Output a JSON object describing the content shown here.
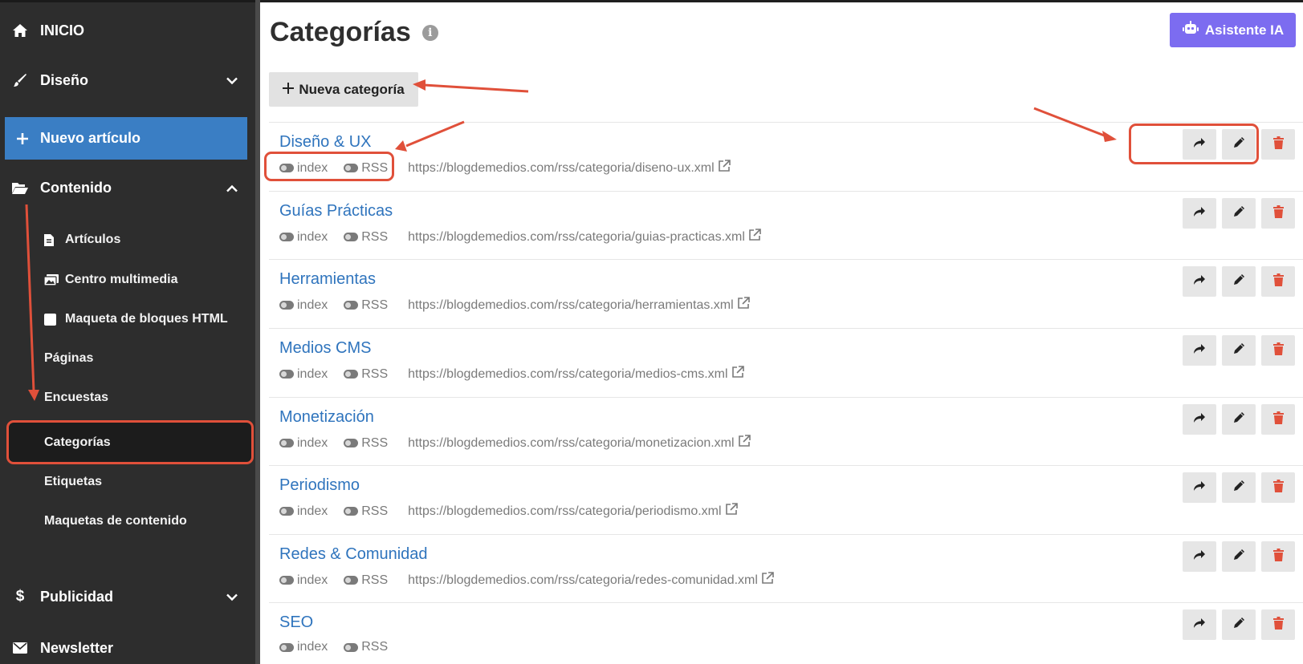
{
  "sidebar": {
    "inicio": "INICIO",
    "diseno": "Diseño",
    "nuevo_articulo": "Nuevo artículo",
    "contenido": "Contenido",
    "articulos": "Artículos",
    "centro_multimedia": "Centro multimedia",
    "maqueta_bloques": "Maqueta de bloques HTML",
    "paginas": "Páginas",
    "encuestas": "Encuestas",
    "categorias": "Categorías",
    "etiquetas": "Etiquetas",
    "maquetas_contenido": "Maquetas de contenido",
    "publicidad": "Publicidad",
    "newsletter": "Newsletter"
  },
  "main": {
    "title": "Categorías",
    "ia_button": "Asistente IA",
    "new_category": "Nueva categoría",
    "toggle_index": "index",
    "toggle_rss": "RSS"
  },
  "categories": [
    {
      "name": "Diseño & UX",
      "url": "https://blogdemedios.com/rss/categoria/diseno-ux.xml"
    },
    {
      "name": "Guías Prácticas",
      "url": "https://blogdemedios.com/rss/categoria/guias-practicas.xml"
    },
    {
      "name": "Herramientas",
      "url": "https://blogdemedios.com/rss/categoria/herramientas.xml"
    },
    {
      "name": "Medios CMS",
      "url": "https://blogdemedios.com/rss/categoria/medios-cms.xml"
    },
    {
      "name": "Monetización",
      "url": "https://blogdemedios.com/rss/categoria/monetizacion.xml"
    },
    {
      "name": "Periodismo",
      "url": "https://blogdemedios.com/rss/categoria/periodismo.xml"
    },
    {
      "name": "Redes & Comunidad",
      "url": "https://blogdemedios.com/rss/categoria/redes-comunidad.xml"
    },
    {
      "name": "SEO",
      "url": ""
    }
  ],
  "colors": {
    "sidebar_bg": "#2d2d2d",
    "accent_blue": "#3a7ec4",
    "link_blue": "#2f74bd",
    "ia_purple": "#7c6cf0",
    "delete_red": "#e0503a",
    "annotation_red": "#e0503a"
  },
  "icons": {
    "inicio": "home-icon",
    "diseno": "brush-icon",
    "nuevo": "plus-icon",
    "contenido": "folder-open-icon",
    "articulos": "file-icon",
    "multimedia": "images-icon",
    "maqueta": "square-icon",
    "publicidad": "dollar-icon",
    "newsletter": "envelope-icon",
    "share": "share-icon",
    "edit": "pencil-icon",
    "delete": "trash-icon",
    "external": "external-link-icon",
    "ia": "robot-icon"
  }
}
